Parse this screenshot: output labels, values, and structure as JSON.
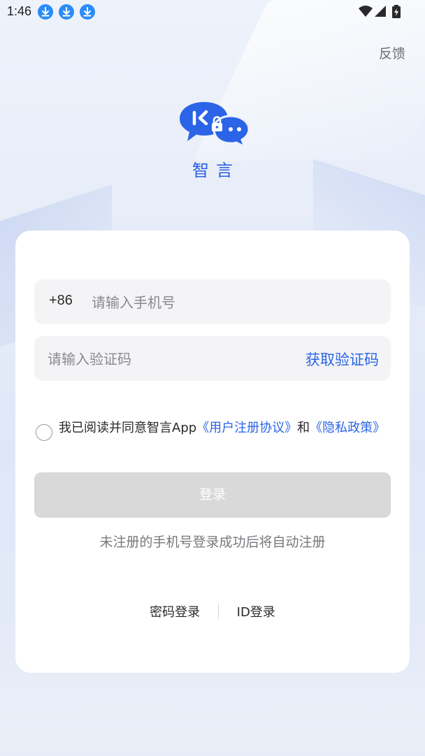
{
  "status_bar": {
    "time": "1:46",
    "notification_icons": [
      "download-icon",
      "download-icon",
      "download-icon"
    ],
    "right_icons": [
      "wifi-icon",
      "signal-icon",
      "battery-charging-icon"
    ]
  },
  "header": {
    "feedback_label": "反馈"
  },
  "brand": {
    "logo_icon": "chat-bubbles-lock-logo",
    "app_name": "智言",
    "accent_color": "#2b64e6"
  },
  "form": {
    "country_code": "+86",
    "phone_placeholder": "请输入手机号",
    "code_placeholder": "请输入验证码",
    "get_code_label": "获取验证码",
    "agreement": {
      "prefix": "我已阅读并同意智言App",
      "user_agreement_link": "《用户注册协议》",
      "conjunction": "和",
      "privacy_link": "《隐私政策》",
      "checked": false
    },
    "login_label": "登录",
    "hint": "未注册的手机号登录成功后将自动注册"
  },
  "alt_login": {
    "password_login": "密码登录",
    "id_login": "ID登录"
  }
}
